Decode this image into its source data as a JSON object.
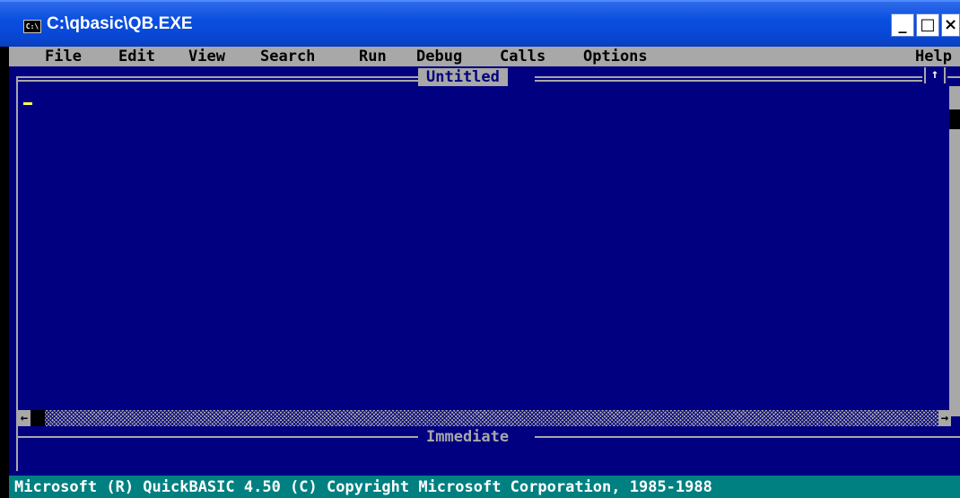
{
  "window": {
    "title": "C:\\qbasic\\QB.EXE",
    "icon_label": "C:\\",
    "minimize_label": "_",
    "maximize_label": "□",
    "close_label": "×"
  },
  "menubar": {
    "items": [
      "File",
      "Edit",
      "View",
      "Search",
      "Run",
      "Debug",
      "Calls",
      "Options"
    ],
    "help_label": "Help"
  },
  "editor": {
    "title": "Untitled",
    "updown_glyph": "↑"
  },
  "scrollbar": {
    "left_arrow": "←",
    "right_arrow": "→"
  },
  "immediate": {
    "title": "Immediate"
  },
  "statusbar": {
    "text": "Microsoft (R) QuickBASIC 4.50 (C) Copyright Microsoft Corporation, 1985-1988"
  },
  "colors": {
    "background": "#000080",
    "frame": "#a8a8a8",
    "statusbar": "#008080",
    "cursor": "#ffff55",
    "titlebar": "#0a4fe0"
  }
}
